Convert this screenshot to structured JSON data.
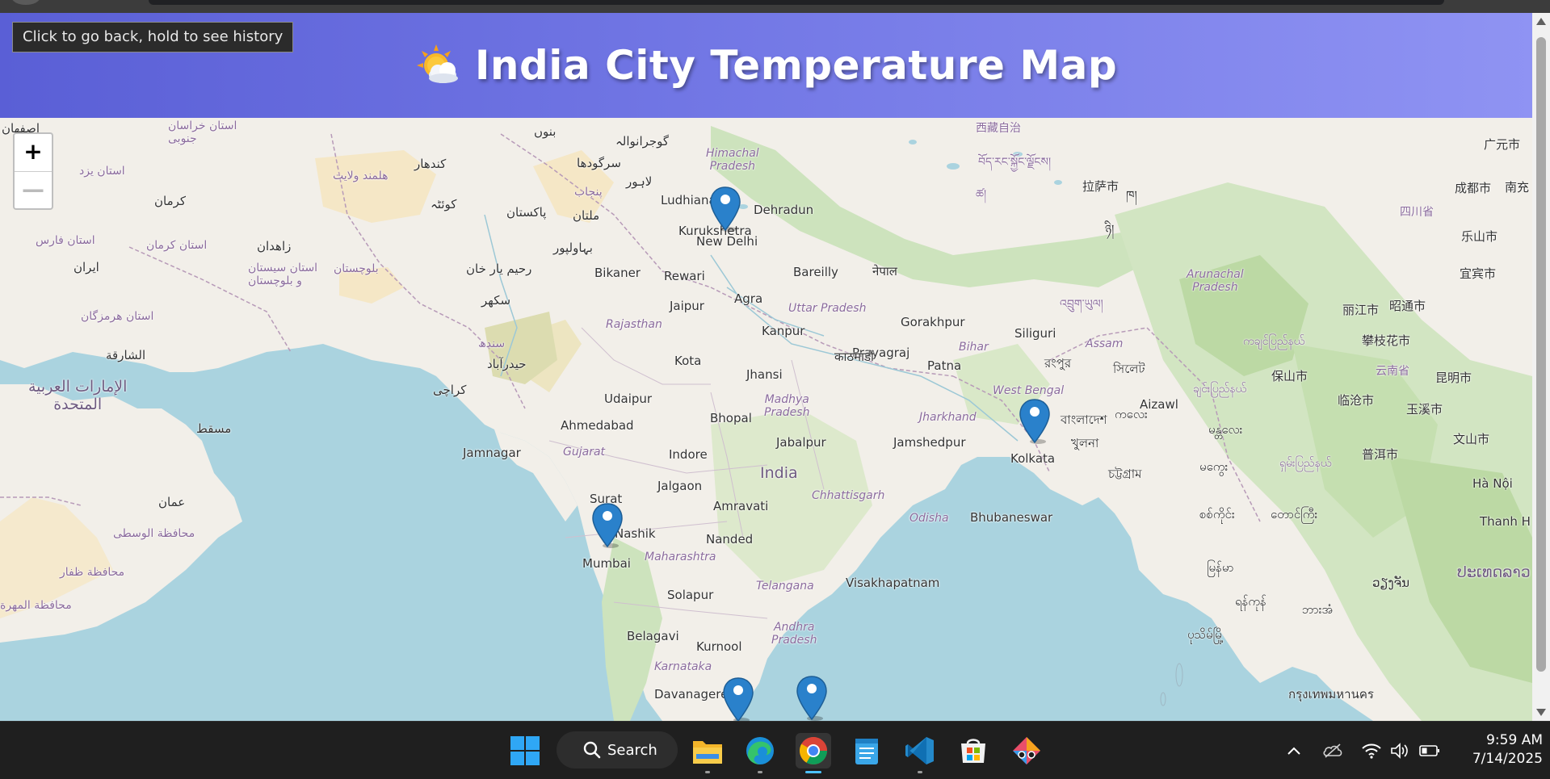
{
  "browser": {
    "back_tooltip": "Click to go back, hold to see history"
  },
  "header": {
    "icon": "sun-behind-cloud-icon",
    "title": "India City Temperature Map"
  },
  "map": {
    "zoom_in_label": "+",
    "zoom_out_label": "—",
    "markers": [
      {
        "city": "New Delhi"
      },
      {
        "city": "Kolkata"
      },
      {
        "city": "Mumbai"
      },
      {
        "city": "Bengaluru"
      },
      {
        "city": "Chennai"
      }
    ],
    "labels": {
      "new_delhi": "New Delhi",
      "kolkata": "Kolkata",
      "mumbai": "Mumbai",
      "ludhiana": "Ludhiana",
      "dehradun": "Dehradun",
      "kurukshetra": "Kurukshetra",
      "bikaner": "Bikaner",
      "rewari": "Rewari",
      "bareilly": "Bareilly",
      "jaipur": "Jaipur",
      "agra": "Agra",
      "kanpur": "Kanpur",
      "prayagraj": "Prayagraj",
      "gorakhpur": "Gorakhpur",
      "patna": "Patna",
      "siliguri": "Siliguri",
      "kota": "Kota",
      "jhansi": "Jhansi",
      "udaipur": "Udaipur",
      "bhopal": "Bhopal",
      "ahmedabad": "Ahmedabad",
      "jamnagar": "Jamnagar",
      "indore": "Indore",
      "jabalpur": "Jabalpur",
      "jamshedpur": "Jamshedpur",
      "india": "India",
      "jalgaon": "Jalgaon",
      "surat": "Surat",
      "amravati": "Amravati",
      "nashik": "Nashik",
      "nanded": "Nanded",
      "bhubaneswar": "Bhubaneswar",
      "solapur": "Solapur",
      "visakhapatnam": "Visakhapatnam",
      "belagavi": "Belagavi",
      "kurnool": "Kurnool",
      "davanagere": "Davanagere",
      "aizawl": "Aizawl",
      "himachal_pradesh": "Himachal\nPradesh",
      "uttar_pradesh": "Uttar Pradesh",
      "rajasthan": "Rajasthan",
      "madhya_pradesh": "Madhya\nPradesh",
      "bihar": "Bihar",
      "jharkhand": "Jharkhand",
      "west_bengal": "West Bengal",
      "gujarat": "Gujarat",
      "chhattisgarh": "Chhattisgarh",
      "odisha": "Odisha",
      "maharashtra": "Maharashtra",
      "telangana": "Telangana",
      "andhra_pradesh": "Andhra\nPradesh",
      "karnataka": "Karnataka",
      "assam": "Assam",
      "arunachal_pradesh": "Arunachal\nPradesh",
      "pakistan": "پاکستان",
      "nepal": "नेपाल",
      "bangladesh": "বাংলাদেশ",
      "iran": "ایران",
      "oman": "عمان",
      "uae": "الإمارات العربية\nالمتحدة",
      "karachi": "کراچی",
      "muscat": "مسقط",
      "kathmandu": "काठमाडौं",
      "lahore": "لاہور",
      "multan": "ملتان",
      "quetta": "کوئٹہ",
      "kandahar": "کندهار",
      "kerman": "کرمان",
      "zahedan": "زاهدان",
      "sharjah": "الشارقة",
      "lhasa": "拉萨市",
      "chengdu": "成都市",
      "kunming": "昆明市",
      "mandalay": "မန္တလေး",
      "hanoi": "Hà Nội",
      "thanh_hoa": "Thanh H",
      "guangyuan": "广元市",
      "nanchong": "南充",
      "leshan": "乐山市",
      "yibin": "宜宾市",
      "zhaotong": "昭通市",
      "lijiang": "丽江市",
      "panzhihua": "攀枝花市",
      "baoshan": "保山市",
      "lincang": "临沧市",
      "yuxi": "玉溪市",
      "wenshan": "文山市",
      "puer": "普洱市",
      "yunnan": "云南省",
      "sichuan": "四川省",
      "tibet": "西藏自治",
      "chittagong": "চট্টগ্রাম",
      "khulna": "খুলনা",
      "sylhet": "সিলেট",
      "rangpur": "রংপুর",
      "sukkur": "سکھر",
      "hyderabad_pk": "حیدرآباد",
      "rahim_yar_khan": "رحیم یار خان",
      "bahawalpur": "بہاولپور",
      "sargodha": "سرگودھا",
      "gujranwala": "گوجرانوالہ",
      "bannu": "بنوں",
      "isfahan": "اصفهان",
      "yazd": "استان یزد",
      "fars": "استان فارس",
      "kerman_prov": "استان کرمان",
      "hormozgan": "استان هرمزگان",
      "sistan": "استان سیستان\nو بلوچستان",
      "khorasan": "استان خراسان\nجنوبی",
      "helmand": "هلمند ولایت",
      "balochistan": "بلوچستان",
      "sindh": "سندھ",
      "punjab_pk": "پنجاب",
      "wusta": "محافظة الوسطى",
      "dhofar": "محافظة ظفار",
      "mahra": "محافظة المهرة",
      "myanmar": "မြန်မာ",
      "laos": "ປະເທດລາວ",
      "vientiane": "ວຽງຈັນ",
      "bangkok": "กรุงเทพมหานคร",
      "yangon": "ရန်ကုန်",
      "bhutan": "འབྲུག་ཡུལ།",
      "tibet_tib": "བོད་རང་སྐྱོང་ལྗོངས།",
      "manipur_my": "ကချင်ပြည်နယ်",
      "shan": "ရှမ်းပြည်နယ်",
      "chin": "ချင်းပြည်နယ်",
      "sagaing": "စစ်ကိုင်း",
      "magway": "မကွေး",
      "taunggyi": "တောင်ကြီး",
      "pathein": "ပုသိမ်မြို့",
      "bago": "ဘားအံ",
      "kalay": "ကလေး",
      "nyingchi": "ཉི།",
      "shigatse": "ཚ།",
      "lhasa_tib": "ཁ།"
    }
  },
  "taskbar": {
    "search_label": "Search",
    "time": "9:59 AM",
    "date": "7/14/2025",
    "apps": [
      "windows-start-icon",
      "file-explorer-icon",
      "edge-icon",
      "chrome-icon",
      "notepad-icon",
      "vscode-icon",
      "microsoft-store-icon",
      "snipping-tool-icon"
    ],
    "tray": [
      "chevron-up-icon",
      "onedrive-icon",
      "wifi-icon",
      "volume-icon",
      "battery-icon"
    ]
  },
  "colors": {
    "header_gradient_start": "#5a5fd6",
    "header_gradient_end": "#8f93f3",
    "water": "#aad3df",
    "land": "#f2efe9",
    "marker": "#2a81cb"
  }
}
